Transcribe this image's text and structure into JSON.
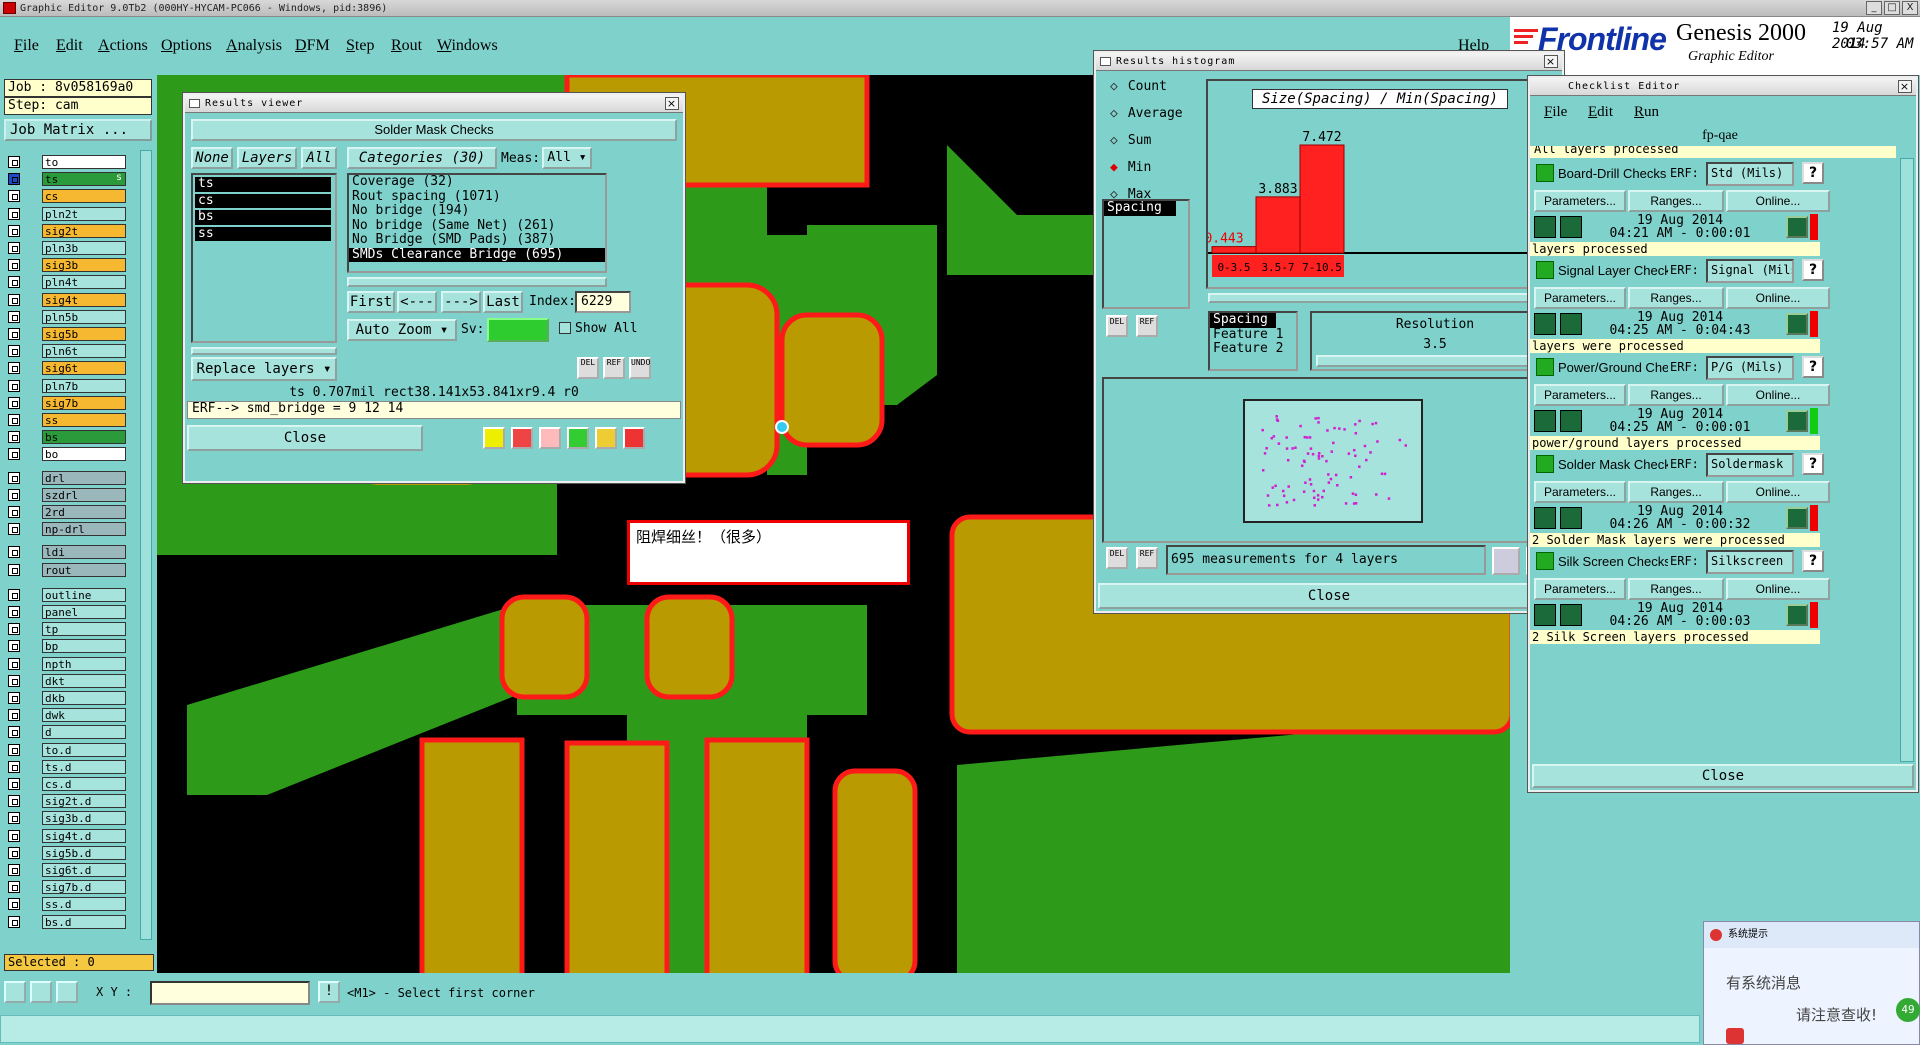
{
  "window": {
    "title": "Graphic Editor 9.0Tb2 (000HY-HYCAM-PC066 - Windows, pid:3896)",
    "controls": [
      "_",
      "□",
      "X"
    ]
  },
  "menu": [
    "File",
    "Edit",
    "Actions",
    "Options",
    "Analysis",
    "DFM",
    "Step",
    "Rout",
    "Windows"
  ],
  "help": "Help",
  "logo": {
    "brand": "Frontline",
    "product": "Genesis 2000",
    "subtitle": "Graphic Editor",
    "date": "19 Aug 2014",
    "time": "03:57 AM"
  },
  "left_panel": {
    "job": "Job : 8v058169a0",
    "step": "Step: cam",
    "job_matrix": "Job Matrix ...",
    "selected": "Selected : 0",
    "layers": [
      {
        "name": "to",
        "color": "#ffffff"
      },
      {
        "name": "ts",
        "color": "#2a9a3a",
        "flag": "s"
      },
      {
        "name": "cs",
        "color": "#f5b830"
      },
      {
        "name": "pln2t",
        "color": "#a7e3dd"
      },
      {
        "name": "sig2t",
        "color": "#f5b830"
      },
      {
        "name": "pln3b",
        "color": "#a7e3dd"
      },
      {
        "name": "sig3b",
        "color": "#f5b830"
      },
      {
        "name": "pln4t",
        "color": "#a7e3dd"
      },
      {
        "name": "sig4t",
        "color": "#f5b830"
      },
      {
        "name": "pln5b",
        "color": "#a7e3dd"
      },
      {
        "name": "sig5b",
        "color": "#f5b830"
      },
      {
        "name": "pln6t",
        "color": "#a7e3dd"
      },
      {
        "name": "sig6t",
        "color": "#f5b830"
      },
      {
        "name": "pln7b",
        "color": "#a7e3dd"
      },
      {
        "name": "sig7b",
        "color": "#f5b830"
      },
      {
        "name": "ss",
        "color": "#f5b830"
      },
      {
        "name": "bs",
        "color": "#2a9a3a"
      },
      {
        "name": "bo",
        "color": "#ffffff"
      },
      {
        "name": "drl",
        "color": "#9ab8bc"
      },
      {
        "name": "szdrl",
        "color": "#9ab8bc"
      },
      {
        "name": "2rd",
        "color": "#9ab8bc"
      },
      {
        "name": "np-drl",
        "color": "#9ab8bc"
      },
      {
        "name": "ldi",
        "color": "#9ab8bc"
      },
      {
        "name": "rout",
        "color": "#9ab8bc"
      },
      {
        "name": "outline",
        "color": "#a7e3dd"
      },
      {
        "name": "panel",
        "color": "#a7e3dd"
      },
      {
        "name": "tp",
        "color": "#a7e3dd"
      },
      {
        "name": "bp",
        "color": "#a7e3dd"
      },
      {
        "name": "npth",
        "color": "#a7e3dd"
      },
      {
        "name": "dkt",
        "color": "#a7e3dd"
      },
      {
        "name": "dkb",
        "color": "#a7e3dd"
      },
      {
        "name": "dwk",
        "color": "#a7e3dd"
      },
      {
        "name": "d",
        "color": "#a7e3dd"
      },
      {
        "name": "to.d",
        "color": "#a7e3dd"
      },
      {
        "name": "ts.d",
        "color": "#a7e3dd"
      },
      {
        "name": "cs.d",
        "color": "#a7e3dd"
      },
      {
        "name": "sig2t.d",
        "color": "#a7e3dd"
      },
      {
        "name": "sig3b.d",
        "color": "#a7e3dd"
      },
      {
        "name": "sig4t.d",
        "color": "#a7e3dd"
      },
      {
        "name": "sig5b.d",
        "color": "#a7e3dd"
      },
      {
        "name": "sig6t.d",
        "color": "#a7e3dd"
      },
      {
        "name": "sig7b.d",
        "color": "#a7e3dd"
      },
      {
        "name": "ss.d",
        "color": "#a7e3dd"
      },
      {
        "name": "bs.d",
        "color": "#a7e3dd"
      }
    ]
  },
  "results_viewer": {
    "title": "Results viewer",
    "header": "Solder Mask Checks",
    "none_btn": "None",
    "layers_btn": "Layers",
    "all_btn": "All",
    "layer_list": [
      "ts",
      "cs",
      "bs",
      "ss"
    ],
    "categories_btn": "Categories (30)",
    "meas_label": "Meas:",
    "meas_value": "All",
    "categories": [
      "Coverage (32)",
      "Rout spacing (1071)",
      "No bridge (194)",
      "No bridge (Same Net) (261)",
      "No Bridge (SMD Pads) (387)",
      "SMDs Clearance Bridge (695)"
    ],
    "first_btn": "First",
    "prev_btn": "<---",
    "next_btn": "--->",
    "last_btn": "Last",
    "index_label": "Index:",
    "index_value": "6229",
    "auto_zoom": "Auto Zoom",
    "sv_label": "Sv:",
    "show_all": "Show All",
    "replace_layers": "Replace layers",
    "measurement": "ts 0.707mil  rect38.141x53.841xr9.4  r0",
    "erf": "ERF--> smd_bridge = 9 12 14",
    "close": "Close",
    "icons": [
      "DEL",
      "REF",
      "UNDO"
    ]
  },
  "histogram": {
    "title": "Results histogram",
    "options": [
      "Count",
      "Average",
      "Sum",
      "Min",
      "Max"
    ],
    "selected_option": "Min",
    "attr": "Spacing",
    "chart_title": "Size(Spacing) / Min(Spacing)",
    "feature_list": [
      "Spacing",
      "Feature 1",
      "Feature 2"
    ],
    "resolution_label": "Resolution",
    "resolution_value": "3.5",
    "measurements": "695 measurements for 4 layers",
    "close": "Close",
    "del": "DEL",
    "ref": "REF"
  },
  "chart_data": {
    "type": "bar",
    "title": "Size(Spacing) / Min(Spacing)",
    "categories": [
      "0-3.5",
      "3.5-7",
      "7-10.5"
    ],
    "values": [
      0.443,
      3.883,
      7.472
    ],
    "value_labels": [
      "0.443",
      "3.883",
      "7.472"
    ],
    "ylim": [
      0,
      7.472
    ],
    "color": "#ff2020"
  },
  "checklist": {
    "title": "Checklist Editor",
    "menu": [
      "File",
      "Edit",
      "Run"
    ],
    "name": "fp-qae",
    "top_line": "All layers processed",
    "close": "Close",
    "items": [
      {
        "name": "Board-Drill Checks",
        "erf": "Std (Mils)",
        "date": "19 Aug 2014",
        "time": "04:21 AM - 0:00:01",
        "status": "layers processed",
        "status_color": "#e00"
      },
      {
        "name": "Signal Layer Checks",
        "erf": "Signal (Mils)",
        "date": "19 Aug 2014",
        "time": "04:25 AM - 0:04:43",
        "status": "layers were processed",
        "status_color": "#e00"
      },
      {
        "name": "Power/Ground Checks",
        "erf": "P/G (Mils)",
        "date": "19 Aug 2014",
        "time": "04:25 AM - 0:00:01",
        "status": "power/ground layers processed",
        "status_color": "#1c1"
      },
      {
        "name": "Solder Mask Checks",
        "erf": "Soldermask",
        "date": "19 Aug 2014",
        "time": "04:26 AM - 0:00:32",
        "status": "2 Solder Mask layers were processed",
        "status_color": "#e00"
      },
      {
        "name": "Silk Screen Checks",
        "erf": "Silkscreen",
        "date": "19 Aug 2014",
        "time": "04:26 AM - 0:00:03",
        "status": "2 Silk Screen layers processed",
        "status_color": "#e00"
      }
    ],
    "parameters": "Parameters...",
    "ranges": "Ranges...",
    "online": "Online...",
    "erf_label": "ERF:"
  },
  "annotation": "阻焊细丝！（很多）",
  "bottom": {
    "xy_label": "X Y :",
    "status": "<M1> - Select first corner"
  },
  "popup": {
    "title": "系统提示",
    "line1": "有系统消息",
    "line2": "请注意查收!",
    "badge": "49"
  }
}
